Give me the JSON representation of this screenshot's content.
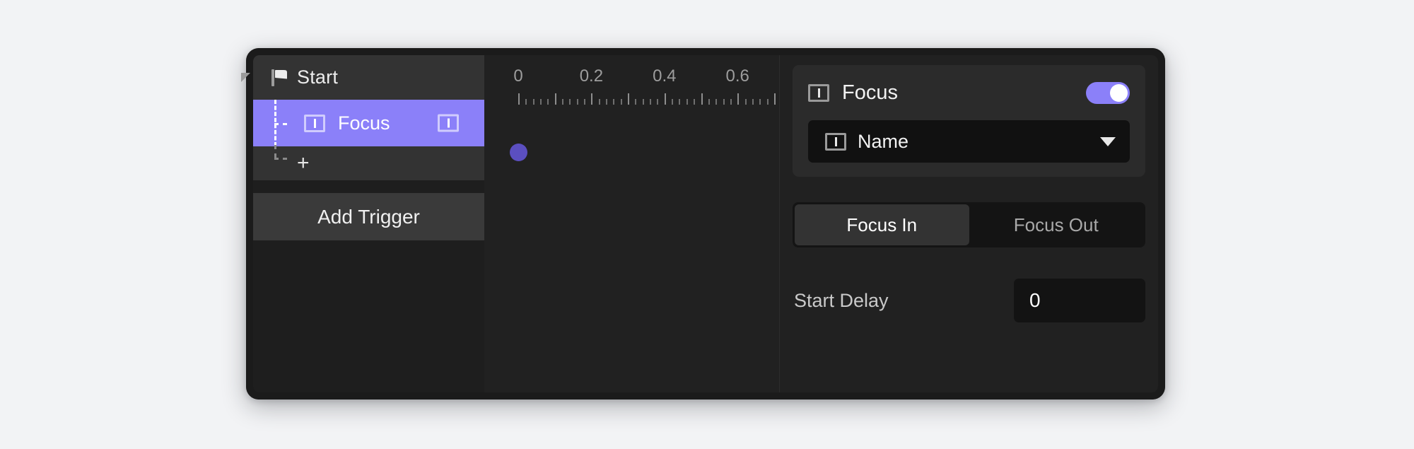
{
  "panel": {
    "caret_icon": "caret-triangle-icon"
  },
  "timeline": {
    "header": {
      "icon": "flag-icon",
      "label": "Start"
    },
    "tracks": [
      {
        "icon": "text-input-icon",
        "label": "Focus",
        "trailing_icon": "text-input-icon",
        "selected": true,
        "keyframe_time": 0
      }
    ],
    "add_track_label": "+",
    "add_trigger_label": "Add Trigger",
    "ruler": {
      "tick_labels": [
        "0",
        "0.2",
        "0.4",
        "0.6"
      ],
      "tick_values": [
        0,
        0.2,
        0.4,
        0.6
      ],
      "major_step": 0.1,
      "minor_per_major": 5,
      "range": [
        0,
        0.8
      ]
    }
  },
  "properties": {
    "title": "Focus",
    "title_icon": "text-input-icon",
    "enabled": true,
    "toggle_state": "on",
    "target_select": {
      "icon": "text-input-icon",
      "value": "Name",
      "chevron_icon": "chevron-down-icon"
    },
    "tabs": [
      {
        "label": "Focus In",
        "active": true
      },
      {
        "label": "Focus Out",
        "active": false
      }
    ],
    "fields": [
      {
        "label": "Start Delay",
        "value": "0"
      }
    ]
  },
  "colors": {
    "accent": "#8b80f9",
    "keyframe": "#5b4fc0",
    "panel_bg": "#1e1e1e",
    "surface": "#212121",
    "card": "#2b2b2b",
    "header_row": "#333333",
    "page_bg": "#f2f3f5"
  }
}
